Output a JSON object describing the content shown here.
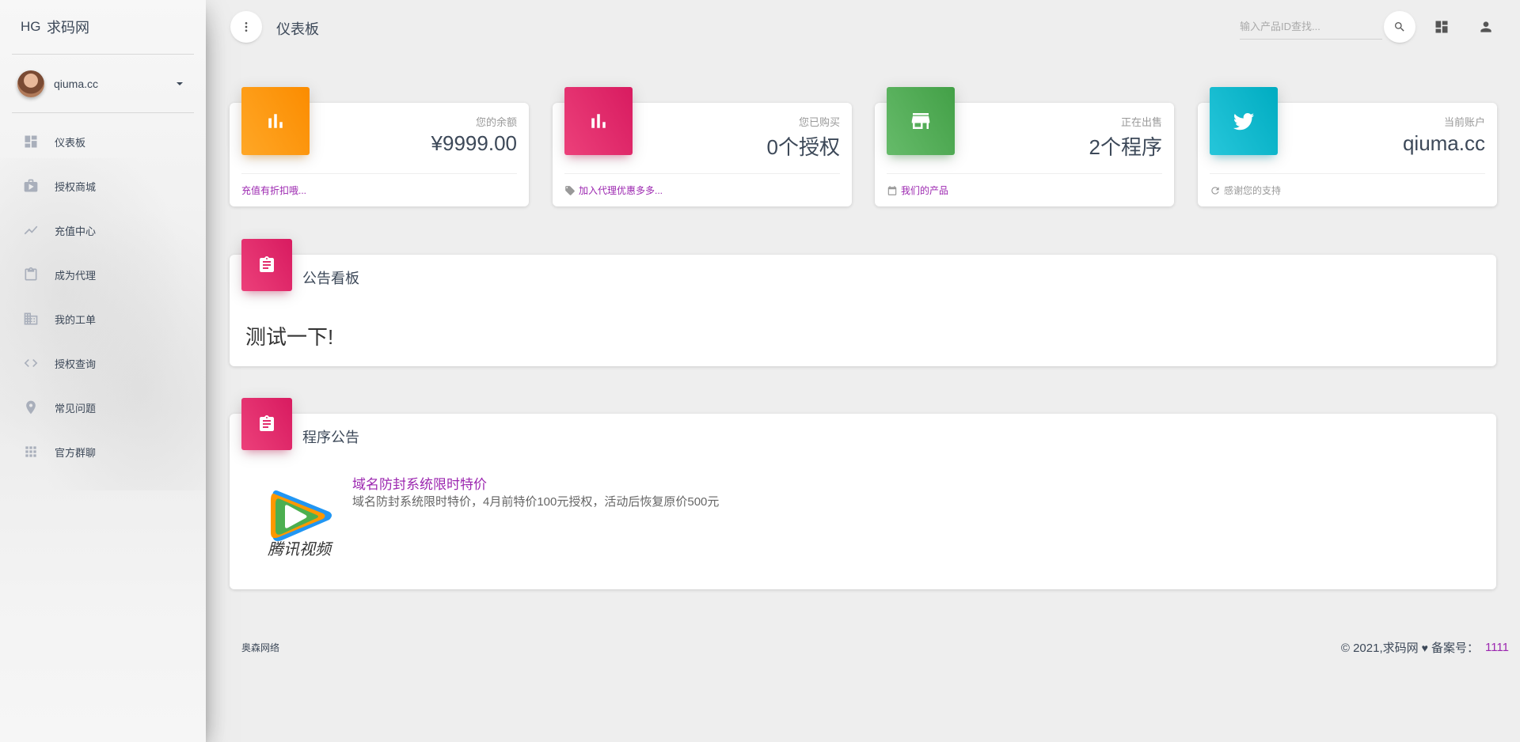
{
  "app": {
    "logo_mini": "HG",
    "logo_text": "求码网",
    "user_name": "qiuma.cc"
  },
  "sidebar": {
    "items": [
      {
        "label": "仪表板",
        "icon": "dashboard-icon"
      },
      {
        "label": "授权商城",
        "icon": "shop-bag-icon"
      },
      {
        "label": "充值中心",
        "icon": "trending-icon"
      },
      {
        "label": "成为代理",
        "icon": "clipboard-icon"
      },
      {
        "label": "我的工单",
        "icon": "building-icon"
      },
      {
        "label": "授权查询",
        "icon": "code-icon"
      },
      {
        "label": "常见问题",
        "icon": "location-pin-icon"
      },
      {
        "label": "官方群聊",
        "icon": "apps-grid-icon"
      }
    ]
  },
  "header": {
    "title": "仪表板",
    "search_placeholder": "输入产品ID查找..."
  },
  "stats": [
    {
      "category": "您的余额",
      "value": "¥9999.00",
      "footer": "充值有折扣哦...",
      "color": "#fb8c00"
    },
    {
      "category": "您已购买",
      "value": "0个授权",
      "footer": "加入代理优惠多多...",
      "color": "#d81b60"
    },
    {
      "category": "正在出售",
      "value": "2个程序",
      "footer": "我们的产品",
      "color": "#43a047"
    },
    {
      "category": "当前账户",
      "value": "qiuma.cc",
      "footer": "感谢您的支持",
      "color": "#00acc1"
    }
  ],
  "notice": {
    "title": "公告看板",
    "content": "测试一下!"
  },
  "program_notice": {
    "title": "程序公告",
    "item_title": "域名防封系统限时特价",
    "item_desc": "域名防封系统限时特价，4月前特价100元授权，活动后恢复原价500元",
    "logo_text": "腾讯视频"
  },
  "footer": {
    "left": "奥森网络",
    "copyright": "© 2021,求码网",
    "icp_label": "备案号：",
    "icp_value": "1111"
  },
  "colors": {
    "accent_purple": "#9c27b0",
    "orange": "#fb8c00",
    "pink": "#d81b60",
    "green": "#43a047",
    "cyan": "#00acc1"
  }
}
